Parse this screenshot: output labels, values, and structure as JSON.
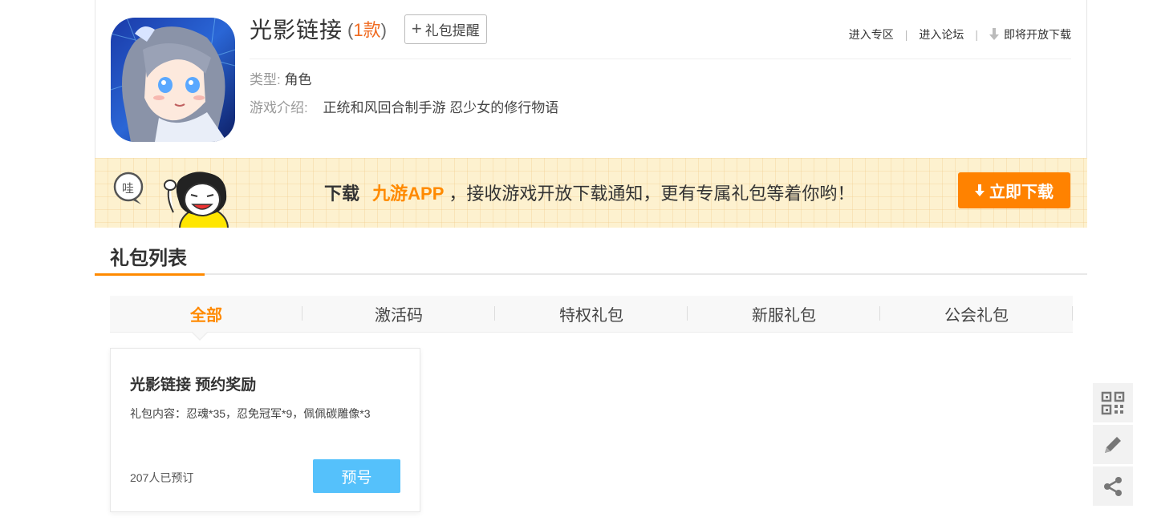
{
  "game": {
    "title": "光影链接",
    "count_open": "(",
    "count_num": "1款",
    "count_close": ")",
    "remind_label": "礼包提醒",
    "type_label": "类型:",
    "type_value": "角色",
    "intro_label": "游戏介绍:",
    "intro_value": "正统和风回合制手游 忍少女的修行物语"
  },
  "top_links": {
    "zone": "进入专区",
    "forum": "进入论坛",
    "download": "即将开放下载",
    "separator": "|"
  },
  "banner": {
    "prefix": "下载",
    "brand": "九游APP",
    "text": "，接收游戏开放下载通知，更有专属礼包等着你哟！",
    "button": "立即下载"
  },
  "section": {
    "title": "礼包列表"
  },
  "tabs": [
    {
      "label": "全部",
      "active": true
    },
    {
      "label": "激活码",
      "active": false
    },
    {
      "label": "特权礼包",
      "active": false
    },
    {
      "label": "新服礼包",
      "active": false
    },
    {
      "label": "公会礼包",
      "active": false
    }
  ],
  "gift": {
    "name": "光影链接 预约奖励",
    "content": "礼包内容：忍魂*35，忍免冠军*9，佩佩碳雕像*3",
    "reserved": "207人已预订",
    "button": "预号"
  },
  "side_tools": [
    "qrcode-icon",
    "edit-icon",
    "share-icon"
  ],
  "colors": {
    "accent": "#ff8a00",
    "count": "#f06b21",
    "gift_button": "#55c1fb",
    "banner_bg": "#fdf1cf"
  }
}
